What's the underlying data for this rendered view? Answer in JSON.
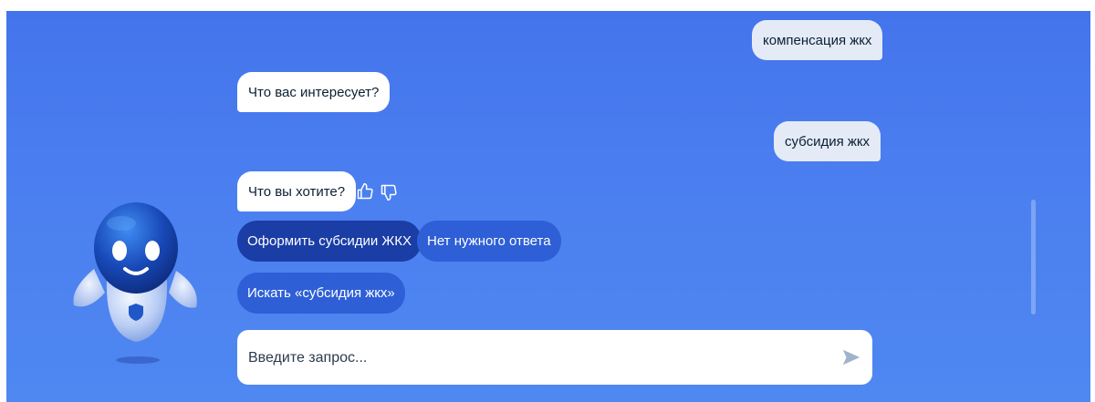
{
  "messages": {
    "user_1": "компенсация жкх",
    "bot_1": "Что вас интересует?",
    "user_2": "субсидия жкх",
    "bot_2": "Что вы хотите?"
  },
  "quick_replies": {
    "apply_subsidy": "Оформить субсидии ЖКХ",
    "no_answer": "Нет нужного ответа",
    "search": "Искать «субсидия жкх»"
  },
  "input": {
    "placeholder": "Введите запрос..."
  },
  "icons": {
    "like": "thumbs-up-icon",
    "dislike": "thumbs-down-icon",
    "send": "send-arrow-icon",
    "assistant": "robot-avatar"
  },
  "colors": {
    "background": "#4b7ff0",
    "user_bubble": "#e4ebf7",
    "bot_bubble": "#ffffff",
    "primary_button": "#1a3da6",
    "secondary_button": "#2e5fd6",
    "send_icon": "#9fb3cc"
  }
}
